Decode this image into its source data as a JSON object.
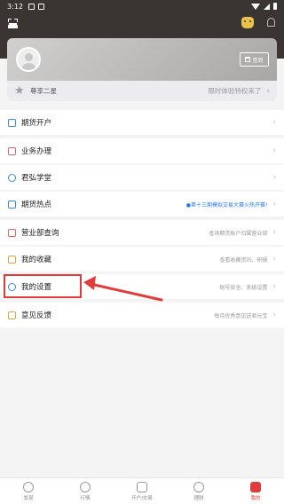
{
  "status_bar": {
    "time": "3:12"
  },
  "header": {
    "icons": [
      "scan-icon",
      "mascot-icon",
      "bell-icon"
    ]
  },
  "profile": {
    "signin_label": "签到"
  },
  "vip": {
    "label": "尊享二星",
    "trial_text": "限时体验特权来了"
  },
  "menu": {
    "items": [
      {
        "label": "期货开户",
        "sub": "",
        "icon": "account-icon",
        "color": "#3c8ad8"
      },
      {
        "label": "业务办理",
        "sub": "",
        "icon": "business-icon",
        "color": "#e56363"
      },
      {
        "label": "君弘学堂",
        "sub": "",
        "icon": "school-icon",
        "color": "#3c8ad8"
      },
      {
        "label": "期货热点",
        "sub": "●第十三期模拟交易大赛火热开赛!",
        "icon": "hot-icon",
        "color": "#3c8ad8"
      },
      {
        "label": "营业部查询",
        "sub": "查询期货账户归属营业部",
        "icon": "branch-icon",
        "color": "#e56363"
      },
      {
        "label": "我的收藏",
        "sub": "查看收藏资讯、研报",
        "icon": "favorite-icon",
        "color": "#e0a23a"
      },
      {
        "label": "我的设置",
        "sub": "账号安全、系统设置",
        "icon": "settings-icon",
        "color": "#3c8ad8"
      },
      {
        "label": "意见反馈",
        "sub": "每月优秀意见送君元宝",
        "icon": "feedback-icon",
        "color": "#e0a23a"
      }
    ]
  },
  "tabbar": {
    "tabs": [
      {
        "label": "发现",
        "active": false
      },
      {
        "label": "行情",
        "active": false
      },
      {
        "label": "开户/交易",
        "active": false
      },
      {
        "label": "理财",
        "active": false
      },
      {
        "label": "我的",
        "active": true
      }
    ]
  },
  "annotation": {
    "color": "#e23b3b"
  }
}
